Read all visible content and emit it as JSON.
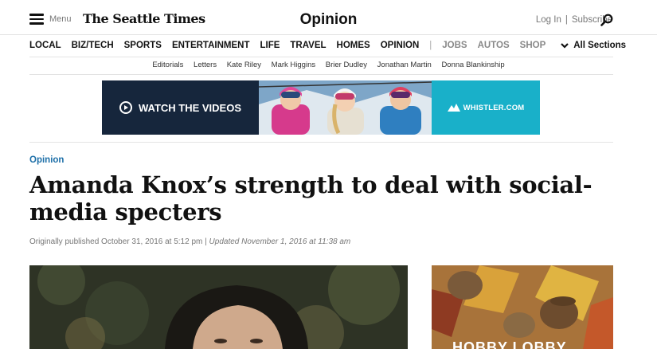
{
  "header": {
    "menu_label": "Menu",
    "logo": "The Seattle Times",
    "section_title": "Opinion",
    "login": "Log In",
    "subscribe": "Subscribe"
  },
  "nav": {
    "items": [
      "LOCAL",
      "BIZ/TECH",
      "SPORTS",
      "ENTERTAINMENT",
      "LIFE",
      "TRAVEL",
      "HOMES",
      "OPINION"
    ],
    "divider": "|",
    "secondary": [
      "JOBS",
      "AUTOS",
      "SHOP"
    ],
    "all_sections": "All Sections"
  },
  "subnav": [
    "Editorials",
    "Letters",
    "Kate Riley",
    "Mark Higgins",
    "Brier Dudley",
    "Jonathan Martin",
    "Donna Blankinship"
  ],
  "ad": {
    "cta": "WATCH THE VIDEOS",
    "brand": "WHISTLER.COM"
  },
  "article": {
    "kicker": "Opinion",
    "headline": "Amanda Knox’s strength to deal with social-media specters",
    "published": "Originally published October 31, 2016 at 5:12 pm",
    "sep": "|",
    "updated": "Updated November 1, 2016 at 11:38 am"
  },
  "side_ad": {
    "text": "HOBBY LOBBY"
  }
}
